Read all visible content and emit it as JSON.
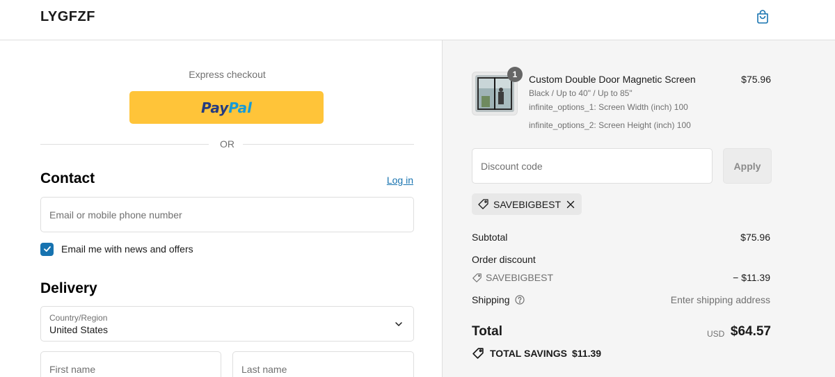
{
  "header": {
    "brand": "LYGFZF",
    "cart_icon": "shopping-bag-icon"
  },
  "express": {
    "label": "Express checkout",
    "paypal_pay": "Pay",
    "paypal_pal": "Pal",
    "or": "OR"
  },
  "contact": {
    "title": "Contact",
    "login": "Log in",
    "email_placeholder": "Email or mobile phone number",
    "newsletter_label": "Email me with news and offers",
    "newsletter_checked": true
  },
  "delivery": {
    "title": "Delivery",
    "country_label": "Country/Region",
    "country_value": "United States",
    "first_name_placeholder": "First name",
    "last_name_placeholder": "Last name"
  },
  "summary": {
    "product": {
      "quantity": "1",
      "name": "Custom Double Door Magnetic Screen",
      "variant": "Black / Up to 40\" / Up to 85\"",
      "option1": "infinite_options_1: Screen Width  (inch)  100",
      "option2": "infinite_options_2: Screen Height  (inch)  100",
      "price": "$75.96"
    },
    "discount_placeholder": "Discount code",
    "apply": "Apply",
    "applied_code": "SAVEBIGBEST",
    "subtotal_label": "Subtotal",
    "subtotal_value": "$75.96",
    "order_discount_label": "Order discount",
    "order_discount_code": "SAVEBIGBEST",
    "order_discount_value": "− $11.39",
    "shipping_label": "Shipping",
    "shipping_value": "Enter shipping address",
    "total_label": "Total",
    "total_currency": "USD",
    "total_value": "$64.57",
    "savings_label": "TOTAL SAVINGS",
    "savings_value": "$11.39"
  },
  "colors": {
    "accent": "#1773b0",
    "paypal_yellow": "#ffc439",
    "summary_bg": "#f5f5f5"
  }
}
